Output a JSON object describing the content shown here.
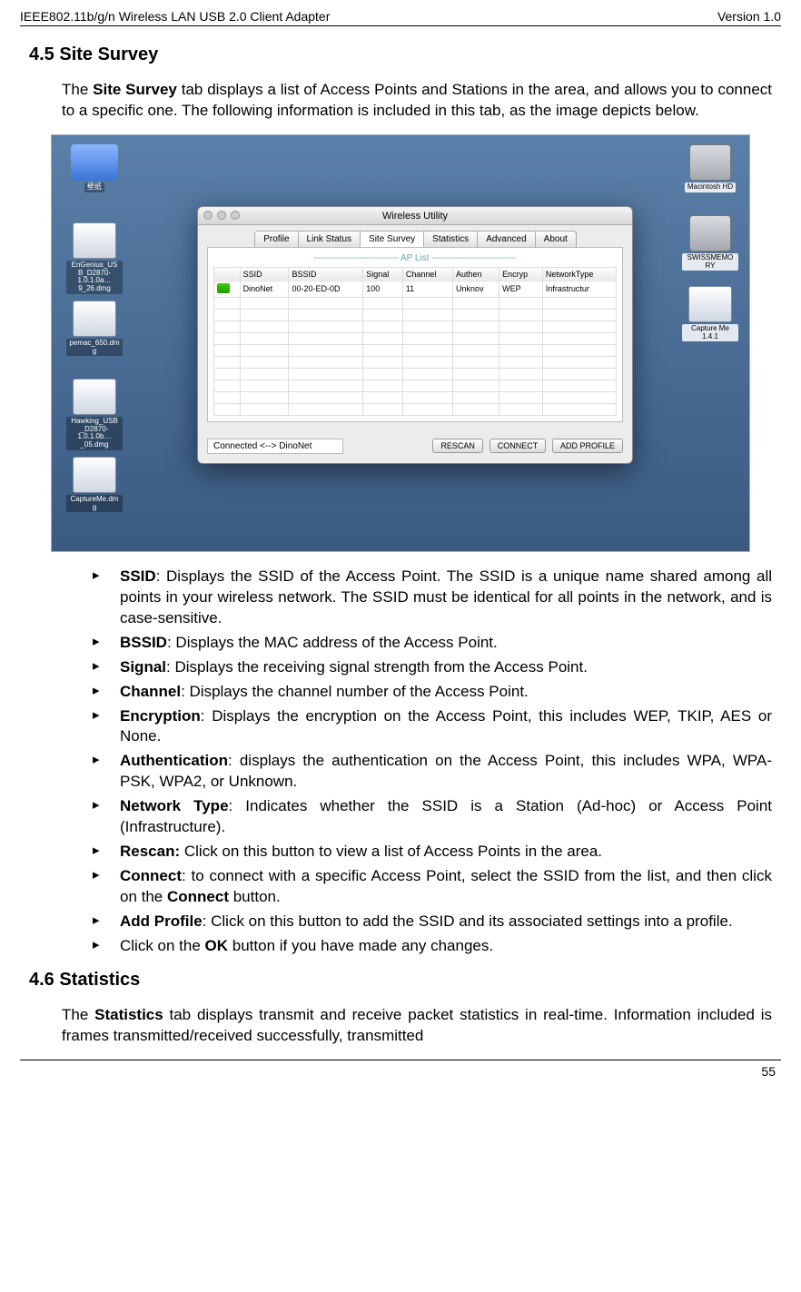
{
  "header": {
    "left": "IEEE802.11b/g/n Wireless LAN USB 2.0 Client Adapter",
    "right": "Version 1.0"
  },
  "sections": {
    "s45": {
      "title": "4.5  Site Survey",
      "intro_before_bold": "The ",
      "intro_bold": "Site Survey",
      "intro_after_bold": " tab displays a list of Access Points and Stations in the area, and allows you to connect to a specific one.  The following information is included in this tab, as the image depicts below."
    },
    "s46": {
      "title": "4.6  Statistics",
      "body_before_bold": "The ",
      "body_bold": "Statistics",
      "body_after_bold": " tab displays transmit and receive packet statistics in real-time. Information included is frames transmitted/received successfully, transmitted"
    }
  },
  "bullets": [
    {
      "lead": "SSID",
      "rest": ": Displays the SSID of the Access Point. The SSID is a unique name shared among all points in your wireless network. The SSID must be identical for all points in the network, and is case-sensitive."
    },
    {
      "lead": "BSSID",
      "rest": ": Displays the MAC address of the Access Point."
    },
    {
      "lead": "Signal",
      "rest": ": Displays the receiving signal strength from the Access Point."
    },
    {
      "lead": "Channel",
      "rest": ": Displays the channel number of the Access Point."
    },
    {
      "lead": "Encryption",
      "rest": ": Displays the encryption on the Access Point, this includes WEP, TKIP, AES or None."
    },
    {
      "lead": "Authentication",
      "rest": ": displays the authentication on the Access Point, this includes WPA, WPA-PSK, WPA2, or Unknown."
    },
    {
      "lead": "Network Type",
      "rest": ": Indicates whether the SSID is a Station (Ad-hoc) or Access Point (Infrastructure)."
    },
    {
      "lead": "Rescan:",
      "rest": " Click on this button to view a list of Access Points in the area."
    },
    {
      "lead": "Connect",
      "rest": ": to connect with a specific Access Point, select the SSID from the list, and then click on the ",
      "bold2": "Connect",
      "rest2": " button."
    },
    {
      "lead": "Add Profile",
      "rest": ": Click on this button to add the SSID and its associated settings into a profile."
    },
    {
      "lead": "",
      "rest": "Click on the ",
      "bold2": "OK",
      "rest2": " button if you have made any changes."
    }
  ],
  "screenshot": {
    "desktop_icons_left": [
      {
        "label": "壁纸",
        "kind": "folder"
      },
      {
        "label": "EnGenius_USB_D2870-1.0.1.0a…9_26.dmg",
        "kind": "glyph"
      },
      {
        "label": "pemac_650.dmg",
        "kind": "glyph"
      },
      {
        "label": "Hawking_USB_D2870-1.0.1.0b…_05.dmg",
        "kind": "glyph"
      },
      {
        "label": "CaptureMe.dmg",
        "kind": "glyph"
      }
    ],
    "desktop_icons_right": [
      {
        "label": "Macintosh HD",
        "kind": "drive"
      },
      {
        "label": "SWISSMEMORY",
        "kind": "drive"
      },
      {
        "label": "Capture Me 1.4.1",
        "kind": "glyph"
      }
    ],
    "window": {
      "title": "Wireless Utility",
      "tabs": [
        "Profile",
        "Link Status",
        "Site Survey",
        "Statistics",
        "Advanced",
        "About"
      ],
      "active_tab_index": 2,
      "ap_list_title": "----------------------------  AP List  ----------------------------",
      "columns": [
        "",
        "SSID",
        "BSSID",
        "Signal",
        "Channel",
        "Authen",
        "Encryp",
        "NetworkType"
      ],
      "row": {
        "ssid": "DinoNet",
        "bssid": "00-20-ED-0D",
        "signal": "100",
        "channel": "11",
        "authen": "Unknov",
        "encryp": "WEP",
        "nettype": "Infrastructur"
      },
      "status": "Connected <--> DinoNet",
      "buttons": {
        "rescan": "RESCAN",
        "connect": "CONNECT",
        "add": "ADD PROFILE"
      }
    }
  },
  "page_number": "55"
}
